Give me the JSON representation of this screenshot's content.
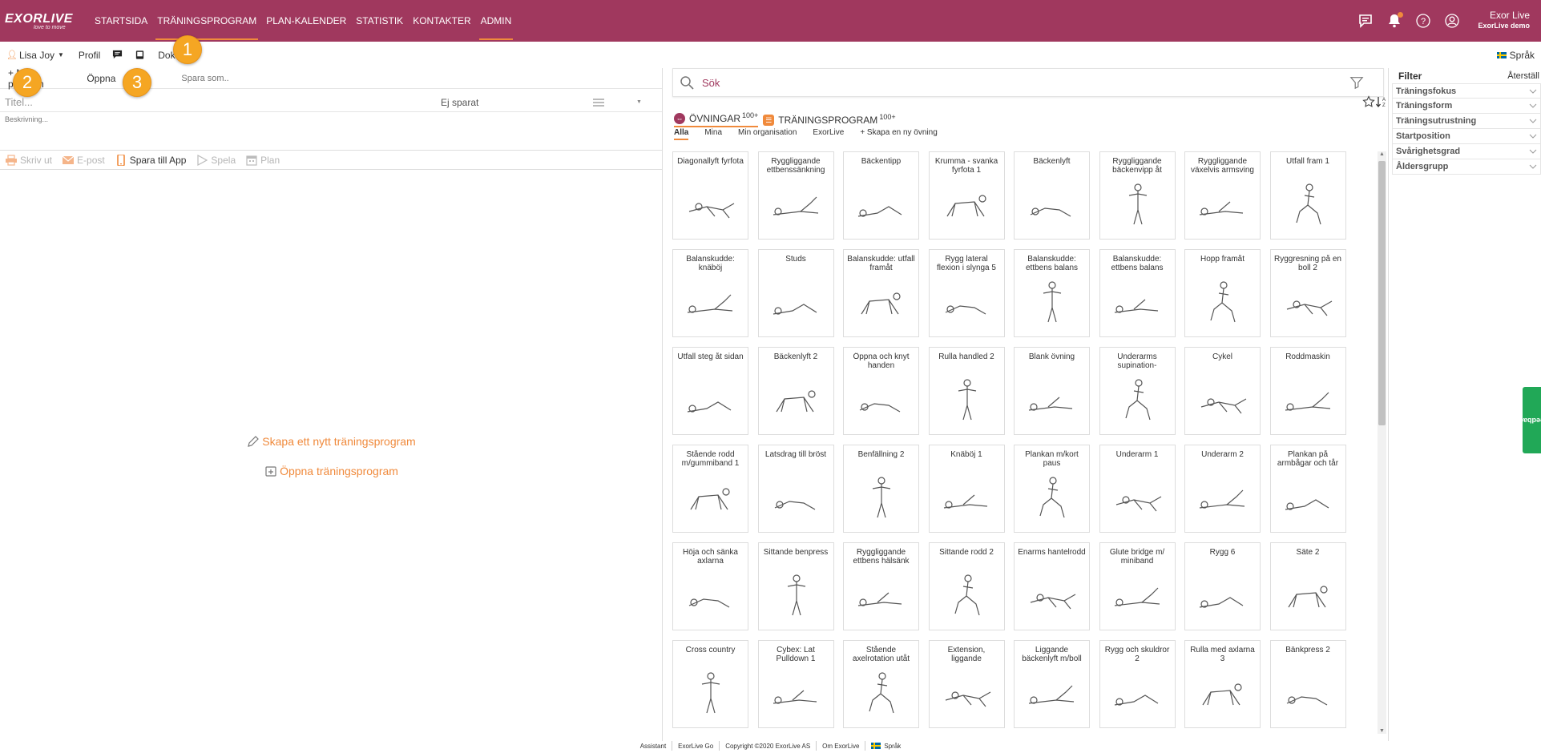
{
  "app": {
    "logo_text": "EXORLIVE",
    "logo_tagline": "love to move",
    "nav": [
      {
        "label": "STARTSIDA",
        "active": false
      },
      {
        "label": "TRÄNINGSPROGRAM",
        "active": true
      },
      {
        "label": "PLAN-KALENDER",
        "active": false
      },
      {
        "label": "STATISTIK",
        "active": false
      },
      {
        "label": "KONTAKTER",
        "active": false
      },
      {
        "label": "ADMIN",
        "active": true
      }
    ],
    "user_name": "Exor Live",
    "user_org": "ExorLive demo",
    "accent": "#a0385e",
    "orange": "#f08a3c"
  },
  "subbar": {
    "user": "Lisa Joy",
    "profile": "Profil",
    "doc": "Dok",
    "lang": "Språk"
  },
  "left": {
    "new_program": "+ Nytt program",
    "open": "Öppna",
    "save_as_placeholder": "Spara som..",
    "title_placeholder": "Titel...",
    "status": "Ej sparat",
    "desc_placeholder": "Beskrivning...",
    "actions": {
      "print": "Skriv ut",
      "email": "E-post",
      "save_app": "Spara till App",
      "play": "Spela",
      "plan": "Plan"
    },
    "create_new": "Skapa ett nytt träningsprogram",
    "open_program": "Öppna träningsprogram"
  },
  "badges": [
    "1",
    "2",
    "3"
  ],
  "middle": {
    "search_placeholder": "Sök",
    "tab_exercises": "ÖVNINGAR",
    "tab_exercises_count": "100+",
    "tab_programs": "TRÄNINGSPROGRAM",
    "tab_programs_count": "100+",
    "subtabs": [
      "Alla",
      "Mina",
      "Min organisation",
      "ExorLive",
      "+ Skapa en ny övning"
    ],
    "exercises": [
      "Diagonallyft fyrfota",
      "Ryggliggande ettbenssänkning",
      "Bäckentipp",
      "Krumma - svanka fyrfota 1",
      "Bäckenlyft",
      "Ryggliggande bäckenvipp åt",
      "Ryggliggande växelvis armsving",
      "Utfall fram 1",
      "Balanskudde: knäböj",
      "Studs",
      "Balanskudde: utfall framåt",
      "Rygg lateral flexion i slynga 5",
      "Balanskudde: ettbens balans",
      "Balanskudde: ettbens balans",
      "Hopp framåt",
      "Ryggresning på en boll 2",
      "Utfall steg åt sidan",
      "Bäckenlyft 2",
      "Öppna och knyt handen",
      "Rulla handled 2",
      "Blank övning",
      "Underarms supination-",
      "Cykel",
      "Roddmaskin",
      "Stående rodd m/gummiband 1",
      "Latsdrag till bröst",
      "Benfällning 2",
      "Knäböj 1",
      "Plankan m/kort paus",
      "Underarm 1",
      "Underarm 2",
      "Plankan på armbågar och tår",
      "Höja och sänka axlarna",
      "Sittande benpress",
      "Ryggliggande ettbens hälsänk",
      "Sittande rodd 2",
      "Enarms hantelrodd",
      "Glute bridge m/ miniband",
      "Rygg 6",
      "Säte 2",
      "Cross country",
      "Cybex: Lat Pulldown 1",
      "Stående axelrotation utåt",
      "Extension, liggande",
      "Liggande bäckenlyft m/boll",
      "Rygg och skuldror 2",
      "Rulla med axlarna 3",
      "Bänkpress 2"
    ]
  },
  "filter": {
    "title": "Filter",
    "reset": "Återställ",
    "items": [
      "Träningsfokus",
      "Träningsform",
      "Träningsutrustning",
      "Startposition",
      "Svårighetsgrad",
      "Åldersgrupp"
    ]
  },
  "feedback": "Feedback",
  "footer": [
    "Assistant",
    "ExorLive Go",
    "Copyright ©2020 ExorLive AS",
    "Om ExorLive",
    "Språk"
  ]
}
